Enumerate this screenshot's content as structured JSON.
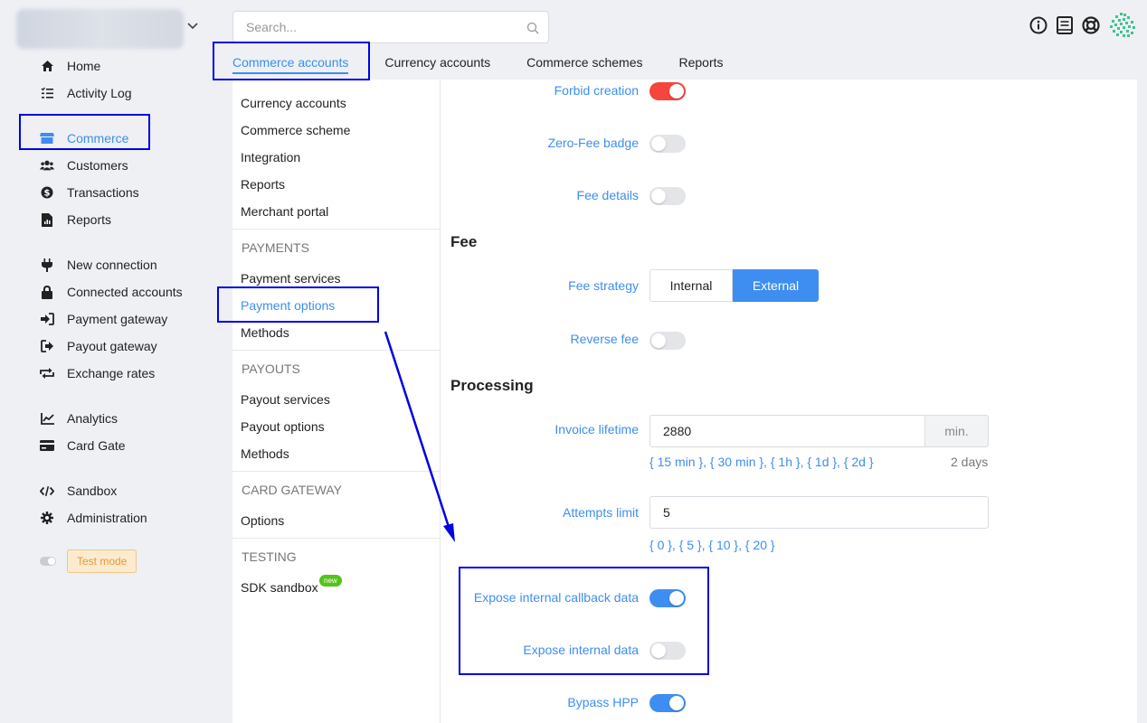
{
  "sidebar": {
    "items": [
      {
        "label": "Home",
        "icon": "home-icon"
      },
      {
        "label": "Activity Log",
        "icon": "list-check-icon"
      },
      {
        "label": "Commerce",
        "icon": "store-icon",
        "active": true
      },
      {
        "label": "Customers",
        "icon": "users-icon"
      },
      {
        "label": "Transactions",
        "icon": "dollar-circle-icon"
      },
      {
        "label": "Reports",
        "icon": "file-report-icon"
      },
      {
        "label": "New connection",
        "icon": "plug-icon"
      },
      {
        "label": "Connected accounts",
        "icon": "lock-icon"
      },
      {
        "label": "Payment gateway",
        "icon": "sign-in-icon"
      },
      {
        "label": "Payout gateway",
        "icon": "sign-out-icon"
      },
      {
        "label": "Exchange rates",
        "icon": "exchange-icon"
      },
      {
        "label": "Analytics",
        "icon": "chart-line-icon"
      },
      {
        "label": "Card Gate",
        "icon": "credit-card-icon"
      },
      {
        "label": "Sandbox",
        "icon": "code-icon"
      },
      {
        "label": "Administration",
        "icon": "gear-icon"
      }
    ],
    "test_mode": "Test mode"
  },
  "search": {
    "placeholder": "Search..."
  },
  "tabs": [
    "Commerce accounts",
    "Currency accounts",
    "Commerce schemes",
    "Reports"
  ],
  "submenu": {
    "general": [
      "Currency accounts",
      "Commerce scheme",
      "Integration",
      "Reports",
      "Merchant portal"
    ],
    "payments_head": "PAYMENTS",
    "payments": [
      "Payment services",
      "Payment options",
      "Methods"
    ],
    "payouts_head": "PAYOUTS",
    "payouts": [
      "Payout services",
      "Payout options",
      "Methods"
    ],
    "card_head": "CARD GATEWAY",
    "card": [
      "Options"
    ],
    "testing_head": "TESTING",
    "testing": [
      "SDK sandbox"
    ],
    "new_badge": "new"
  },
  "settings": {
    "forbid_creation": "Forbid creation",
    "zero_fee_badge": "Zero-Fee badge",
    "fee_details": "Fee details",
    "fee_title": "Fee",
    "fee_strategy": "Fee strategy",
    "fee_internal": "Internal",
    "fee_external": "External",
    "reverse_fee": "Reverse fee",
    "processing_title": "Processing",
    "invoice_lifetime": "Invoice lifetime",
    "invoice_value": "2880",
    "invoice_unit": "min.",
    "invoice_quick": "{ 15 min }, { 30 min }, { 1h }, { 1d }, { 2d }",
    "invoice_hint": "2 days",
    "attempts_limit": "Attempts limit",
    "attempts_value": "5",
    "attempts_quick": "{ 0 }, { 5 }, { 10 }, { 20 }",
    "expose_callback": "Expose internal callback data",
    "expose_internal": "Expose internal data",
    "bypass_hpp": "Bypass HPP"
  },
  "colors": {
    "accent": "#3d8ef0",
    "danger": "#f5453d",
    "annotation": "#0000e6"
  }
}
